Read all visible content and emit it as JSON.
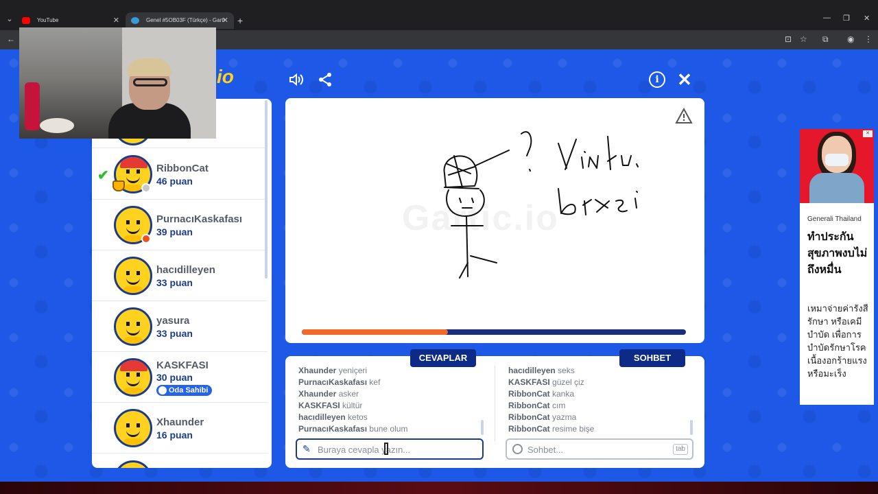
{
  "browser": {
    "tabs": [
      {
        "label": "YouTube"
      },
      {
        "label": "Genel #5OB03F (Türkçe) - Garti"
      }
    ]
  },
  "players": [
    {
      "name": "RibbonCat",
      "score": "46 puan",
      "status_color": "#c8c8c8"
    },
    {
      "name": "PurnacıKaskafası",
      "score": "39 puan",
      "status_color": "#e8541c"
    },
    {
      "name": "hacıdilleyen",
      "score": "33 puan"
    },
    {
      "name": "yasura",
      "score": "33 puan"
    },
    {
      "name": "KASKFASI",
      "score": "30 puan",
      "badge": "Oda Sahibi"
    },
    {
      "name": "Xhaunder",
      "score": "16 puan"
    }
  ],
  "canvas": {
    "watermark": "Gartic.io",
    "progress": 0.38,
    "progress_color": "#f26a2a",
    "track_color": "#1a2f7a"
  },
  "panels": {
    "answers_label": "CEVAPLAR",
    "chat_label": "SOHBET",
    "answers": [
      {
        "user": "Xhaunder",
        "text": "yeniçeri"
      },
      {
        "user": "PurnacıKaskafası",
        "text": "kef"
      },
      {
        "user": "Xhaunder",
        "text": "asker"
      },
      {
        "user": "KASKFASI",
        "text": "kültür"
      },
      {
        "user": "hacıdilleyen",
        "text": "ketos"
      },
      {
        "user": "PurnacıKaskafası",
        "text": "bune olum"
      }
    ],
    "chat": [
      {
        "user": "hacıdilleyen",
        "text": "seks"
      },
      {
        "user": "KASKFASI",
        "text": "güzel çiz"
      },
      {
        "user": "RibbonCat",
        "text": "kanka"
      },
      {
        "user": "RibbonCat",
        "text": "cım"
      },
      {
        "user": "RibbonCat",
        "text": "yazma"
      },
      {
        "user": "RibbonCat",
        "text": "resime bişe"
      }
    ],
    "answer_placeholder": "Buraya cevapla yazın...",
    "chat_placeholder": "Sohbet...",
    "tab_key": "tab"
  },
  "ad": {
    "sponsor": "Generali Thailand",
    "headline": "ทำประกันสุขภาพงบไม่ถึงหมื่น",
    "body": "เหมาจ่ายค่ารังสีรักษา หรือเคมีบำบัด เพื่อการบำบัดรักษาโรคเนื้องอกร้ายแรงหรือมะเร็ง"
  },
  "colors": {
    "page_bg": "#1d58e6",
    "accent_navy": "#0d2a86",
    "name_gray": "#555a66",
    "score_blue": "#1a3a8a"
  },
  "icons": [
    "speaker-icon",
    "share-icon",
    "info-icon",
    "close-icon",
    "warning-icon",
    "pencil-icon",
    "chat-bubble-icon",
    "check-icon",
    "trophy-icon"
  ]
}
